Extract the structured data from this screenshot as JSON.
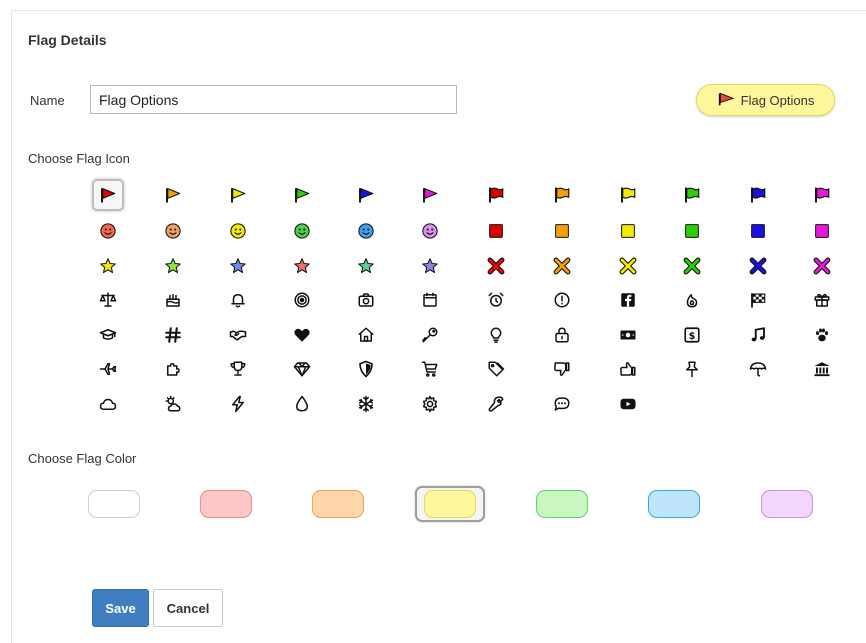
{
  "dialog": {
    "title": "Flag Details",
    "name_label": "Name",
    "name_value": "Flag Options",
    "preview_label": "Flag Options",
    "choose_icon_label": "Choose Flag Icon",
    "choose_color_label": "Choose Flag Color",
    "save_label": "Save",
    "cancel_label": "Cancel"
  },
  "palette": {
    "red": "#e00000",
    "orange": "#f5a000",
    "yellow": "#f2ea00",
    "green": "#2bd000",
    "blue": "#1a10e0",
    "magenta": "#e818d8",
    "black": "#111111"
  },
  "icons": {
    "selected": "pennant-red",
    "rows": [
      [
        "pennant-red",
        "pennant-orange",
        "pennant-yellow",
        "pennant-green",
        "pennant-blue",
        "pennant-magenta",
        "flag-red",
        "flag-orange",
        "flag-yellow",
        "flag-green",
        "flag-blue",
        "flag-magenta"
      ],
      [
        "smiley-red",
        "smiley-orange",
        "smiley-yellow",
        "smiley-green",
        "smiley-blue",
        "smiley-purple",
        "square-red",
        "square-orange",
        "square-yellow",
        "square-green",
        "square-blue",
        "square-magenta"
      ],
      [
        "star-yellow",
        "star-green",
        "star-blue",
        "star-red",
        "star-green-outline",
        "star-purple",
        "x-red",
        "x-orange",
        "x-yellow",
        "x-green",
        "x-blue",
        "x-magenta"
      ],
      [
        "balance-scale",
        "birthday-cake",
        "bell",
        "bullseye",
        "camera",
        "calendar",
        "alarm-clock",
        "exclamation-circle",
        "facebook",
        "fire",
        "checkered-flag",
        "gift"
      ],
      [
        "graduation-cap",
        "hashtag",
        "handshake",
        "heart",
        "home",
        "key",
        "lightbulb",
        "lock",
        "money-bill",
        "dollar-square",
        "music-note",
        "paw"
      ],
      [
        "airplane",
        "puzzle-piece",
        "trophy",
        "gem",
        "shield",
        "shopping-cart",
        "tag",
        "thumbs-down",
        "thumbs-up",
        "thumbtack",
        "umbrella",
        "bank"
      ],
      [
        "cloud",
        "cloud-sun",
        "bolt",
        "droplet",
        "snowflake",
        "cog",
        "wrench",
        "comment-dots",
        "youtube"
      ]
    ]
  },
  "colors": {
    "selected": "yellow",
    "swatches": [
      {
        "name": "white",
        "fill": "#ffffff",
        "border": "#cfcfcf"
      },
      {
        "name": "red",
        "fill": "#ffc7c7",
        "border": "#e88e8e"
      },
      {
        "name": "orange",
        "fill": "#ffd7aa",
        "border": "#eaa256"
      },
      {
        "name": "yellow",
        "fill": "#fff79c",
        "border": "#e2d76b"
      },
      {
        "name": "green",
        "fill": "#c8f7c0",
        "border": "#66d066"
      },
      {
        "name": "blue",
        "fill": "#bfe5fb",
        "border": "#39a8e0"
      },
      {
        "name": "purple",
        "fill": "#f2d6fb",
        "border": "#cf8fe6"
      }
    ]
  }
}
